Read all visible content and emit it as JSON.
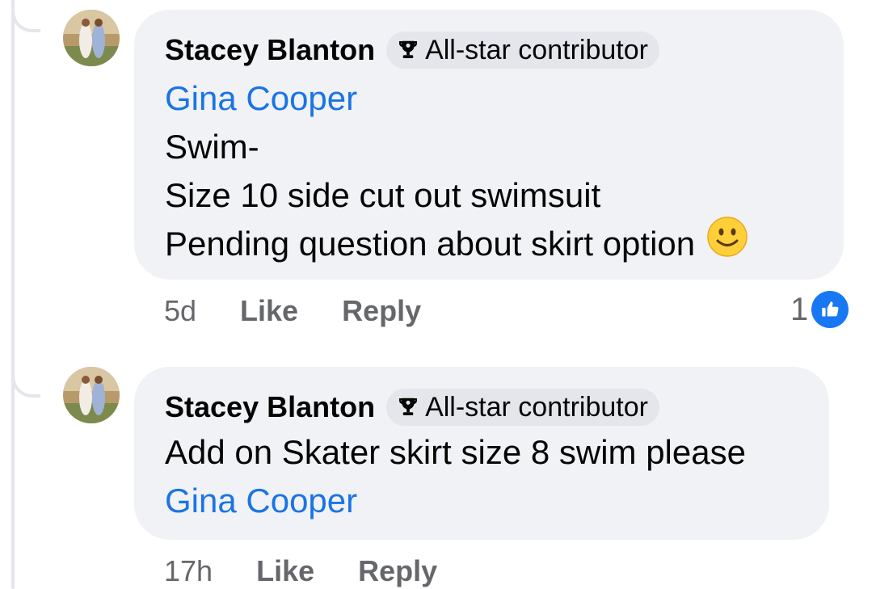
{
  "comments": [
    {
      "author": "Stacey Blanton",
      "badge": "All-star contributor",
      "mention_top": "Gina Cooper",
      "lines": [
        "Swim-",
        "Size 10 side cut out swimsuit",
        "Pending question about skirt option"
      ],
      "emoji": "slightly-smiling-face-emoji",
      "time": "5d",
      "like_label": "Like",
      "reply_label": "Reply",
      "reaction_count": "1",
      "reaction_icon": "thumbs-up-icon"
    },
    {
      "author": "Stacey Blanton",
      "badge": "All-star contributor",
      "lines": [
        "Add on Skater skirt size 8 swim please"
      ],
      "mention_bottom": "Gina Cooper",
      "time": "17h",
      "like_label": "Like",
      "reply_label": "Reply"
    }
  ],
  "colors": {
    "bubble": "#f0f2f5",
    "badge": "#e4e6eb",
    "mention": "#1b74e4",
    "meta": "#65676b",
    "like": "#1877f2"
  }
}
